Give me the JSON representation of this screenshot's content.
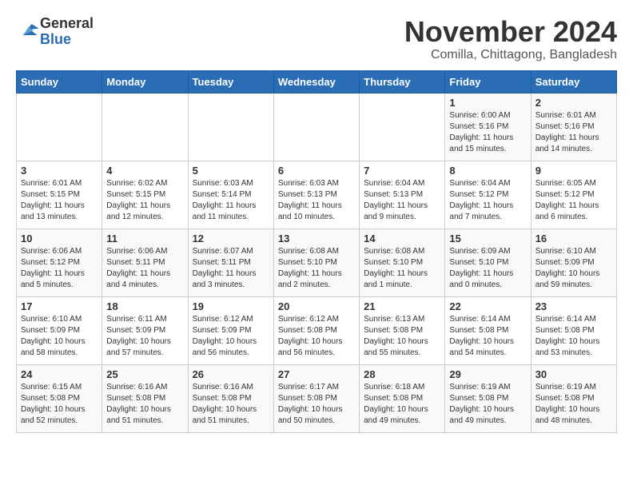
{
  "logo": {
    "general": "General",
    "blue": "Blue"
  },
  "title": "November 2024",
  "subtitle": "Comilla, Chittagong, Bangladesh",
  "headers": [
    "Sunday",
    "Monday",
    "Tuesday",
    "Wednesday",
    "Thursday",
    "Friday",
    "Saturday"
  ],
  "weeks": [
    [
      {
        "day": "",
        "info": ""
      },
      {
        "day": "",
        "info": ""
      },
      {
        "day": "",
        "info": ""
      },
      {
        "day": "",
        "info": ""
      },
      {
        "day": "",
        "info": ""
      },
      {
        "day": "1",
        "info": "Sunrise: 6:00 AM\nSunset: 5:16 PM\nDaylight: 11 hours\nand 15 minutes."
      },
      {
        "day": "2",
        "info": "Sunrise: 6:01 AM\nSunset: 5:16 PM\nDaylight: 11 hours\nand 14 minutes."
      }
    ],
    [
      {
        "day": "3",
        "info": "Sunrise: 6:01 AM\nSunset: 5:15 PM\nDaylight: 11 hours\nand 13 minutes."
      },
      {
        "day": "4",
        "info": "Sunrise: 6:02 AM\nSunset: 5:15 PM\nDaylight: 11 hours\nand 12 minutes."
      },
      {
        "day": "5",
        "info": "Sunrise: 6:03 AM\nSunset: 5:14 PM\nDaylight: 11 hours\nand 11 minutes."
      },
      {
        "day": "6",
        "info": "Sunrise: 6:03 AM\nSunset: 5:13 PM\nDaylight: 11 hours\nand 10 minutes."
      },
      {
        "day": "7",
        "info": "Sunrise: 6:04 AM\nSunset: 5:13 PM\nDaylight: 11 hours\nand 9 minutes."
      },
      {
        "day": "8",
        "info": "Sunrise: 6:04 AM\nSunset: 5:12 PM\nDaylight: 11 hours\nand 7 minutes."
      },
      {
        "day": "9",
        "info": "Sunrise: 6:05 AM\nSunset: 5:12 PM\nDaylight: 11 hours\nand 6 minutes."
      }
    ],
    [
      {
        "day": "10",
        "info": "Sunrise: 6:06 AM\nSunset: 5:12 PM\nDaylight: 11 hours\nand 5 minutes."
      },
      {
        "day": "11",
        "info": "Sunrise: 6:06 AM\nSunset: 5:11 PM\nDaylight: 11 hours\nand 4 minutes."
      },
      {
        "day": "12",
        "info": "Sunrise: 6:07 AM\nSunset: 5:11 PM\nDaylight: 11 hours\nand 3 minutes."
      },
      {
        "day": "13",
        "info": "Sunrise: 6:08 AM\nSunset: 5:10 PM\nDaylight: 11 hours\nand 2 minutes."
      },
      {
        "day": "14",
        "info": "Sunrise: 6:08 AM\nSunset: 5:10 PM\nDaylight: 11 hours\nand 1 minute."
      },
      {
        "day": "15",
        "info": "Sunrise: 6:09 AM\nSunset: 5:10 PM\nDaylight: 11 hours\nand 0 minutes."
      },
      {
        "day": "16",
        "info": "Sunrise: 6:10 AM\nSunset: 5:09 PM\nDaylight: 10 hours\nand 59 minutes."
      }
    ],
    [
      {
        "day": "17",
        "info": "Sunrise: 6:10 AM\nSunset: 5:09 PM\nDaylight: 10 hours\nand 58 minutes."
      },
      {
        "day": "18",
        "info": "Sunrise: 6:11 AM\nSunset: 5:09 PM\nDaylight: 10 hours\nand 57 minutes."
      },
      {
        "day": "19",
        "info": "Sunrise: 6:12 AM\nSunset: 5:09 PM\nDaylight: 10 hours\nand 56 minutes."
      },
      {
        "day": "20",
        "info": "Sunrise: 6:12 AM\nSunset: 5:08 PM\nDaylight: 10 hours\nand 56 minutes."
      },
      {
        "day": "21",
        "info": "Sunrise: 6:13 AM\nSunset: 5:08 PM\nDaylight: 10 hours\nand 55 minutes."
      },
      {
        "day": "22",
        "info": "Sunrise: 6:14 AM\nSunset: 5:08 PM\nDaylight: 10 hours\nand 54 minutes."
      },
      {
        "day": "23",
        "info": "Sunrise: 6:14 AM\nSunset: 5:08 PM\nDaylight: 10 hours\nand 53 minutes."
      }
    ],
    [
      {
        "day": "24",
        "info": "Sunrise: 6:15 AM\nSunset: 5:08 PM\nDaylight: 10 hours\nand 52 minutes."
      },
      {
        "day": "25",
        "info": "Sunrise: 6:16 AM\nSunset: 5:08 PM\nDaylight: 10 hours\nand 51 minutes."
      },
      {
        "day": "26",
        "info": "Sunrise: 6:16 AM\nSunset: 5:08 PM\nDaylight: 10 hours\nand 51 minutes."
      },
      {
        "day": "27",
        "info": "Sunrise: 6:17 AM\nSunset: 5:08 PM\nDaylight: 10 hours\nand 50 minutes."
      },
      {
        "day": "28",
        "info": "Sunrise: 6:18 AM\nSunset: 5:08 PM\nDaylight: 10 hours\nand 49 minutes."
      },
      {
        "day": "29",
        "info": "Sunrise: 6:19 AM\nSunset: 5:08 PM\nDaylight: 10 hours\nand 49 minutes."
      },
      {
        "day": "30",
        "info": "Sunrise: 6:19 AM\nSunset: 5:08 PM\nDaylight: 10 hours\nand 48 minutes."
      }
    ]
  ]
}
